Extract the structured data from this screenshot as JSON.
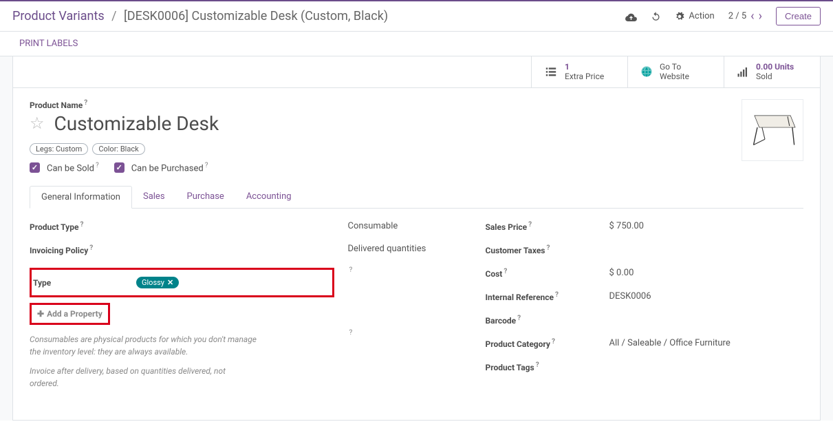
{
  "header": {
    "breadcrumb_root": "Product Variants",
    "breadcrumb_current": "[DESK0006] Customizable Desk (Custom, Black)",
    "action_label": "Action",
    "pager": "2 / 5",
    "create_label": "Create"
  },
  "sub_header": {
    "print_labels": "PRINT LABELS"
  },
  "stats": {
    "extra_price_val": "1",
    "extra_price_label": "Extra Price",
    "website_line1": "Go To",
    "website_line2": "Website",
    "sold_val": "0.00 Units",
    "sold_label": "Sold"
  },
  "product": {
    "name_label": "Product Name",
    "name": "Customizable Desk",
    "pill1": "Legs: Custom",
    "pill2": "Color: Black",
    "can_be_sold": "Can be Sold",
    "can_be_purchased": "Can be Purchased"
  },
  "tabs": {
    "general": "General Information",
    "sales": "Sales",
    "purchase": "Purchase",
    "accounting": "Accounting"
  },
  "left_col": {
    "product_type_label": "Product Type",
    "product_type_val": "Consumable",
    "invoicing_label": "Invoicing Policy",
    "invoicing_val": "Delivered quantities",
    "type_label": "Type",
    "type_tag": "Glossy",
    "add_property": "Add a Property",
    "help1": "Consumables are physical products for which you don't manage the inventory level: they are always available.",
    "help2": "Invoice after delivery, based on quantities delivered, not ordered."
  },
  "right_col": {
    "sales_price_label": "Sales Price",
    "sales_price_val": "$ 750.00",
    "customer_taxes_label": "Customer Taxes",
    "cost_label": "Cost",
    "cost_val": "$ 0.00",
    "internal_ref_label": "Internal Reference",
    "internal_ref_val": "DESK0006",
    "barcode_label": "Barcode",
    "category_label": "Product Category",
    "category_val": "All / Saleable / Office Furniture",
    "tags_label": "Product Tags"
  }
}
